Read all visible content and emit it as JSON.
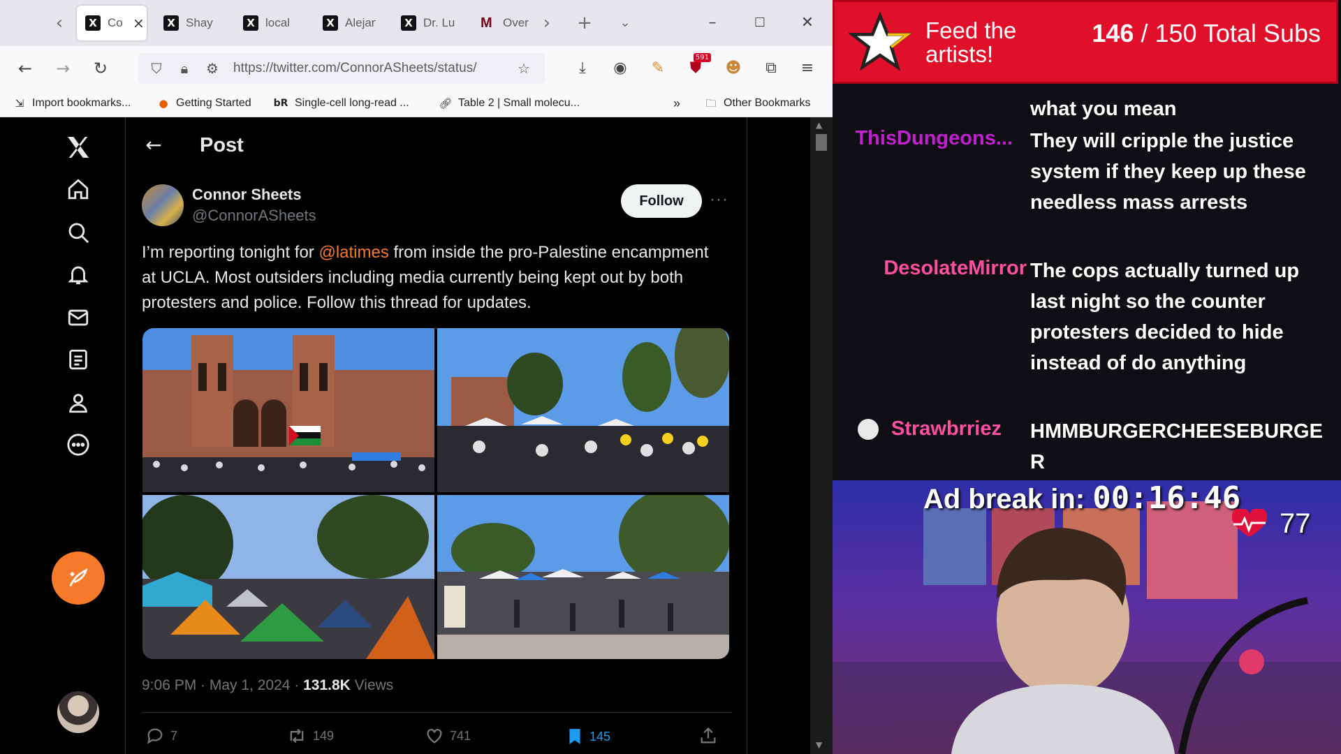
{
  "browser": {
    "tabs": [
      {
        "label": "Co",
        "icon": "x-logo",
        "active": true
      },
      {
        "label": "Shay",
        "icon": "x-logo"
      },
      {
        "label": "local",
        "icon": "x-logo"
      },
      {
        "label": "Alejan",
        "icon": "x-logo"
      },
      {
        "label": "Dr. Lu",
        "icon": "x-logo"
      },
      {
        "label": "Over",
        "icon": "m-logo"
      }
    ],
    "url": "https://twitter.com/ConnorASheets/status/",
    "extension_badge": "591",
    "bookmarks": [
      {
        "label": "Import bookmarks...",
        "icon": "import-icon"
      },
      {
        "label": "Getting Started",
        "icon": "firefox-icon"
      },
      {
        "label": "Single-cell long-read ...",
        "icon": "br-icon",
        "prefix": "bR"
      },
      {
        "label": "Table 2 | Small molecu...",
        "icon": "link-icon"
      }
    ],
    "other_bookmarks": "Other Bookmarks"
  },
  "twitter": {
    "header_title": "Post",
    "author": {
      "name": "Connor Sheets",
      "handle": "@ConnorASheets"
    },
    "follow_label": "Follow",
    "tweet": {
      "before": "I’m reporting tonight for ",
      "mention": "@latimes",
      "after": " from inside the pro-Palestine encampment at UCLA. Most outsiders including media currently being kept out by both protesters and police. Follow this thread for updates."
    },
    "meta": {
      "time": "9:06 PM · May 1, 2024 · ",
      "views_count": "131.8K",
      "views_label": " Views"
    },
    "actions": {
      "replies": "7",
      "reposts": "149",
      "likes": "741",
      "bookmarks": "145"
    }
  },
  "overlay": {
    "banner": {
      "line1": "Feed the",
      "line2": "artists!",
      "subs_current": "146",
      "subs_rest": " / 150 Total Subs"
    },
    "chat": [
      {
        "user": "",
        "text": "what you mean",
        "color": "#ffffff"
      },
      {
        "user": "ThisDungeons...",
        "text": "They will cripple the justice system if they keep up these needless mass arrests",
        "color": "#c020d0"
      },
      {
        "user": "DesolateMirror",
        "text": "The cops actually turned up last night so the counter protesters decided to hide instead of do anything",
        "color": "#ff4fa3"
      },
      {
        "user": "Strawbrriez",
        "text": "HMMBURGERCHEESEBURGE R",
        "color": "#ff4fa3"
      }
    ],
    "ad_break": {
      "label": "Ad break in: ",
      "timer": "00:16:46"
    },
    "heart_rate": "77"
  },
  "colors": {
    "accent": "#f7792a",
    "banner": "#e0102b",
    "bookmark_active": "#1d9bf0"
  }
}
